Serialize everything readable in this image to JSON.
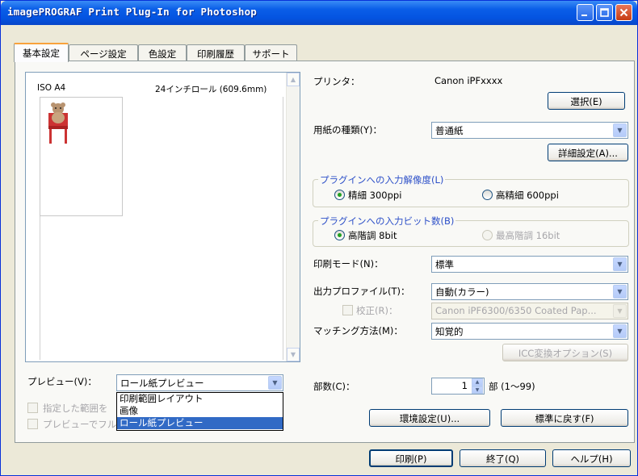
{
  "window": {
    "title": "imagePROGRAF Print Plug-In for Photoshop"
  },
  "tabs": [
    {
      "label": "基本設定",
      "active": true
    },
    {
      "label": "ページ設定",
      "active": false
    },
    {
      "label": "色設定",
      "active": false
    },
    {
      "label": "印刷履歴",
      "active": false
    },
    {
      "label": "サポート",
      "active": false
    }
  ],
  "preview": {
    "paper_size": "ISO A4",
    "roll_info": "24インチロール (609.6mm)",
    "preview_label": "プレビュー(V)：",
    "preview_selected": "ロール紙プレビュー",
    "preview_options": [
      "印刷範囲レイアウト",
      "画像",
      "ロール紙プレビュー"
    ],
    "check_specified_range": "指定した範囲を",
    "check_full_preview": "プレビューでフル"
  },
  "printer": {
    "label": "プリンタ：",
    "value": "Canon iPFxxxx",
    "select_button": "選択(E)"
  },
  "media": {
    "label": "用紙の種類(Y)：",
    "value": "普通紙",
    "detail_button": "詳細設定(A)..."
  },
  "resolution": {
    "group_label": "プラグインへの入力解像度(L)",
    "option1": "精細 300ppi",
    "option2": "高精細 600ppi",
    "selected": "精細 300ppi"
  },
  "bitdepth": {
    "group_label": "プラグインへの入力ビット数(B)",
    "option1": "高階調 8bit",
    "option2": "最高階調 16bit",
    "selected": "高階調 8bit"
  },
  "print_mode": {
    "label": "印刷モード(N)：",
    "value": "標準"
  },
  "output_profile": {
    "label": "出力プロファイル(T)：",
    "value": "自動(カラー)"
  },
  "proof": {
    "label": "校正(R)：",
    "value": "Canon iPF6300/6350 Coated Pap..."
  },
  "matching": {
    "label": "マッチング方法(M)：",
    "value": "知覚的",
    "icc_button": "ICC変換オプション(S)"
  },
  "copies": {
    "label": "部数(C)：",
    "value": "1",
    "unit": "部 (1～99)"
  },
  "footer_buttons": {
    "env": "環境設定(U)...",
    "default": "標準に戻す(F)",
    "print": "印刷(P)",
    "exit": "終了(Q)",
    "help": "ヘルプ(H)"
  },
  "colors": {
    "titlebar": "#0a5ee8",
    "selection": "#316ac5",
    "tab_highlight": "#f9a23c",
    "group_label": "#2c4fc8"
  }
}
